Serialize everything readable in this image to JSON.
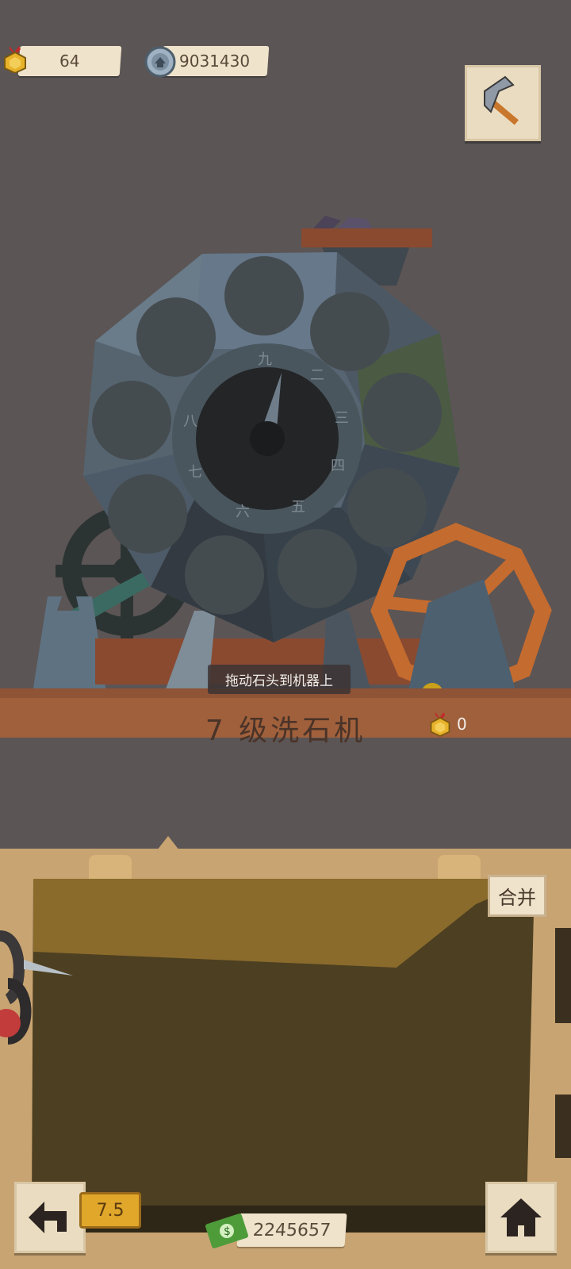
{
  "hud": {
    "medals": "64",
    "stones": "9031430"
  },
  "machine": {
    "hint": "拖动石头到机器上",
    "title": "7 级洗石机",
    "reward_medals": "0",
    "dial_marks": [
      "九",
      "二",
      "三",
      "四",
      "五",
      "六",
      "七",
      "八"
    ]
  },
  "panel": {
    "merge_label": "合并"
  },
  "bottom": {
    "level_badge": "7.5",
    "money": "2245657"
  },
  "icons": {
    "medal": "medal-icon",
    "stone": "stone-coin-icon",
    "pickaxe": "pickaxe-icon",
    "back": "back-arrow-icon",
    "home": "home-icon",
    "money": "money-icon"
  },
  "colors": {
    "background": "#5b5555",
    "wood": "#a0603c",
    "panel": "#c8a472",
    "paper": "#efe3cc"
  }
}
